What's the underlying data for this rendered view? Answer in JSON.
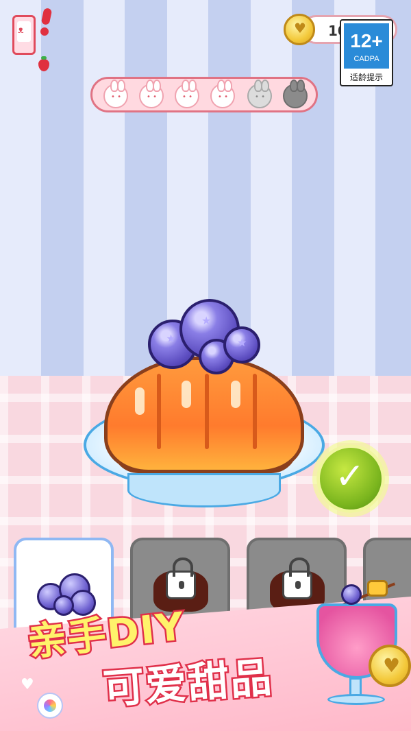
{
  "header": {
    "coin_amount": "10",
    "age_badge": {
      "rating": "12+",
      "org": "CADPA",
      "hint": "适龄提示"
    },
    "progress": {
      "completed": 4,
      "total": 6
    }
  },
  "ingredients": [
    {
      "name": "blueberry",
      "state": "selected"
    },
    {
      "name": "locked-1",
      "state": "locked"
    },
    {
      "name": "locked-2",
      "state": "locked"
    },
    {
      "name": "locked-3",
      "state": "locked"
    }
  ],
  "promo": {
    "line1": "亲手DIY",
    "line2": "可爱甜品"
  },
  "icons": {
    "phone": "phone-bunny-icon",
    "coin": "bunny-coin-icon",
    "confirm": "check-icon",
    "lock": "lock-icon"
  },
  "colors": {
    "accent_red": "#e0303f",
    "confirm_green": "#7ab51e",
    "plate_blue": "#4aa9e4"
  }
}
